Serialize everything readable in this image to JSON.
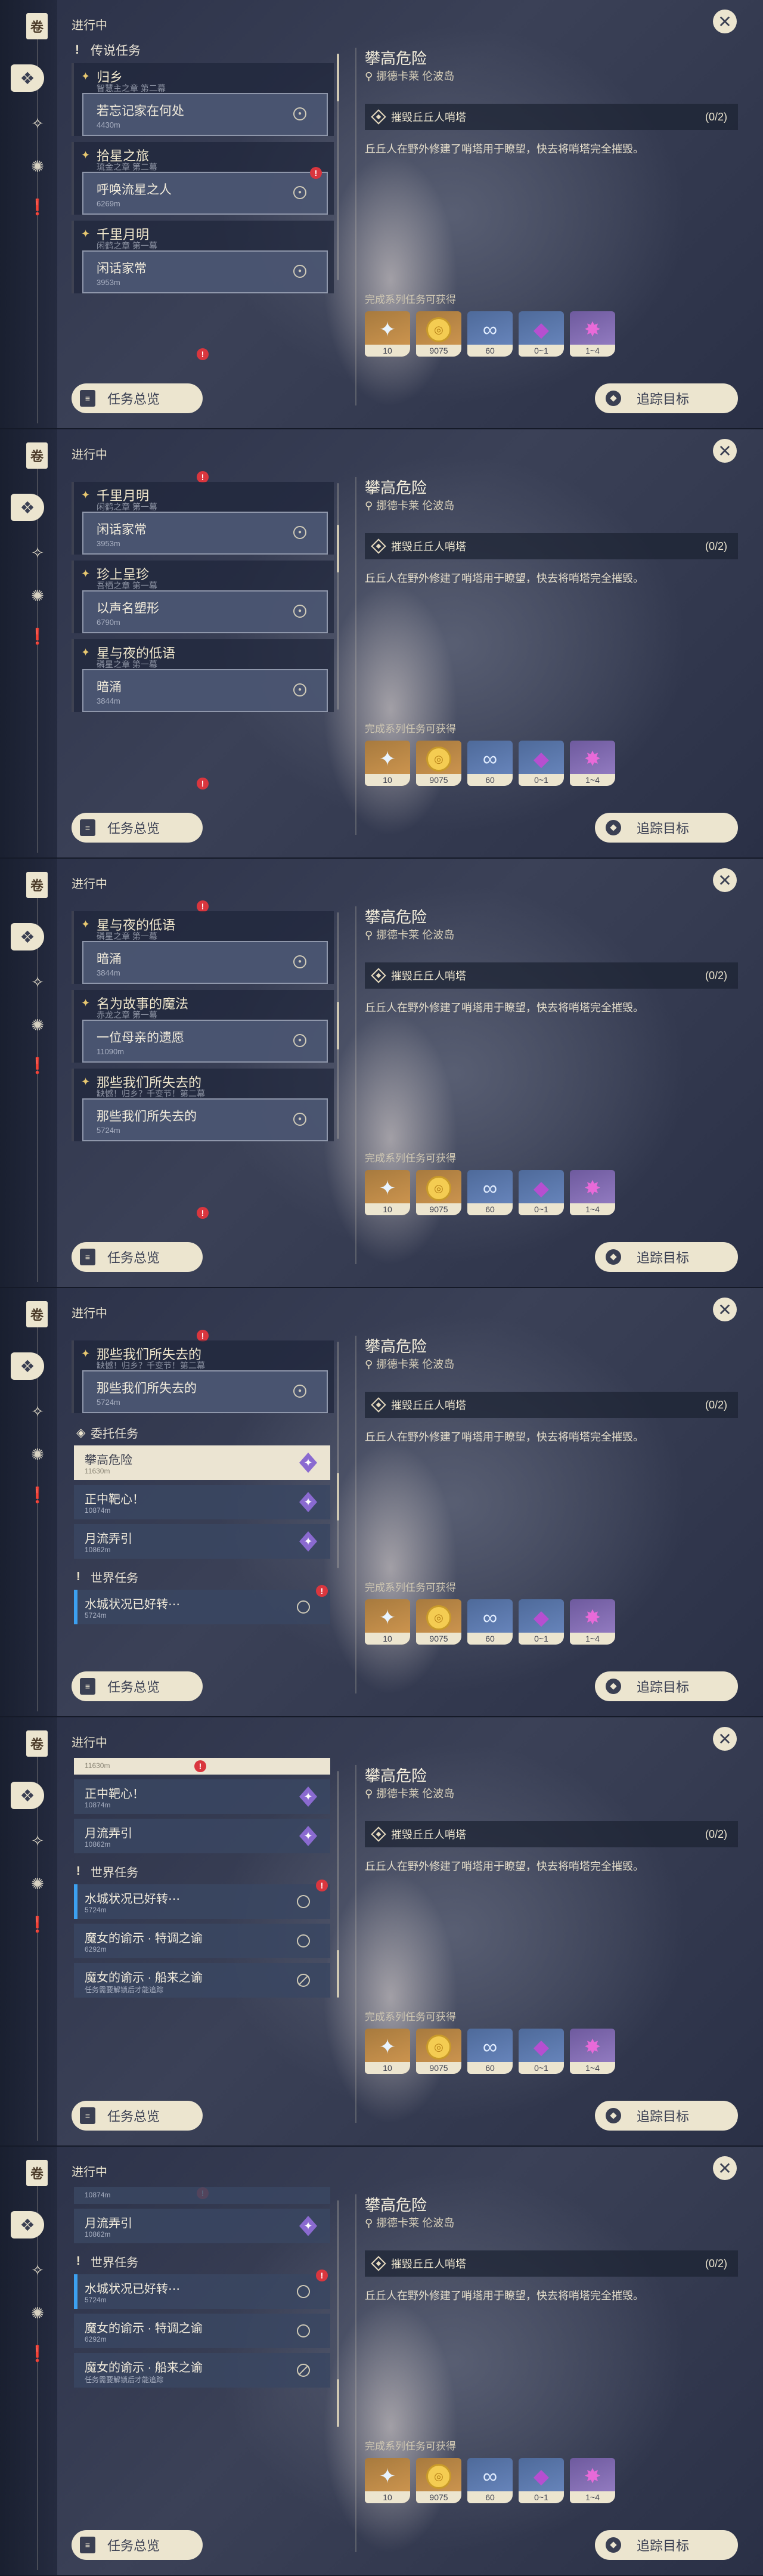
{
  "rail": {
    "book_glyph": "卷",
    "icons": [
      "diamond-quest-icon",
      "compass-icon",
      "flower-icon",
      "exclamation-icon"
    ]
  },
  "list_header": "进行中",
  "categories": {
    "legend": "传说任务",
    "commission": "委托任务",
    "world": "世界任务"
  },
  "quests": {
    "guixiang": {
      "title": "归乡",
      "subtitle": "智慧主之章 第二幕",
      "step": "若忘记家在何处",
      "dist": "4430m"
    },
    "shixing": {
      "title": "拾星之旅",
      "subtitle": "琉金之章 第二幕",
      "step": "呼唤流星之人",
      "dist": "6269m"
    },
    "qianli": {
      "title": "千里月明",
      "subtitle": "闲鹤之章 第一幕",
      "step": "闲话家常",
      "dist": "3953m"
    },
    "zhenshang": {
      "title": "珍上呈珍",
      "subtitle": "吾栖之章 第一幕",
      "step": "以声名塑形",
      "dist": "6790m"
    },
    "xingyu": {
      "title": "星与夜的低语",
      "subtitle": "磷星之章 第一幕",
      "step": "暗涌",
      "dist": "3844m"
    },
    "mingwei": {
      "title": "名为故事的魔法",
      "subtitle": "赤龙之章 第一幕",
      "step": "一位母亲的遗愿",
      "dist": "11090m"
    },
    "nashie": {
      "title": "那些我们所失去的",
      "subtitle": "缺憾！归乡？千变节！第二幕",
      "step": "那些我们所失去的",
      "dist": "5724m"
    }
  },
  "commissions": [
    {
      "title": "攀高危险",
      "dist": "11630m"
    },
    {
      "title": "正中靶心！",
      "dist": "10874m"
    },
    {
      "title": "月流弄引",
      "dist": "10862m"
    }
  ],
  "world_quests": [
    {
      "title": "水城状况已好转⋯",
      "dist": "5724m"
    },
    {
      "title": "魔女的谕示 · 特调之谕",
      "dist": "6292m"
    },
    {
      "title": "魔女的谕示 · 船来之谕",
      "dist": "任务需要解锁后才能追踪"
    }
  ],
  "buttons": {
    "overview": "任务总览",
    "overview_icon_glyph": "≡",
    "track": "追踪目标",
    "close_glyph": "✕"
  },
  "detail": {
    "title": "攀高危险",
    "location": "挪德卡莱 伦波岛",
    "objective": "摧毁丘丘人哨塔",
    "progress": "(0/2)",
    "description": "丘丘人在野外修建了哨塔用于瞭望，快去将哨塔完全摧毁。",
    "reward_header": "完成系列任务可获得",
    "rewards": [
      {
        "icon": "star-icon",
        "glyph": "✦",
        "count": "10"
      },
      {
        "icon": "mora-coin-icon",
        "glyph": "◎",
        "count": "9075"
      },
      {
        "icon": "exp-book-icon",
        "glyph": "∞",
        "count": "60"
      },
      {
        "icon": "crystal-icon",
        "glyph": "◆",
        "count": "0~1"
      },
      {
        "icon": "ore-icon",
        "glyph": "✸",
        "count": "1~4"
      }
    ]
  },
  "badge_glyph": "!",
  "colors": {
    "accent_cream": "#ece5cf",
    "bg_dark": "#2b3148",
    "alert_red": "#d9363e",
    "commission_purple": "#8a6ad0",
    "track_blue": "#3ca0f0"
  }
}
